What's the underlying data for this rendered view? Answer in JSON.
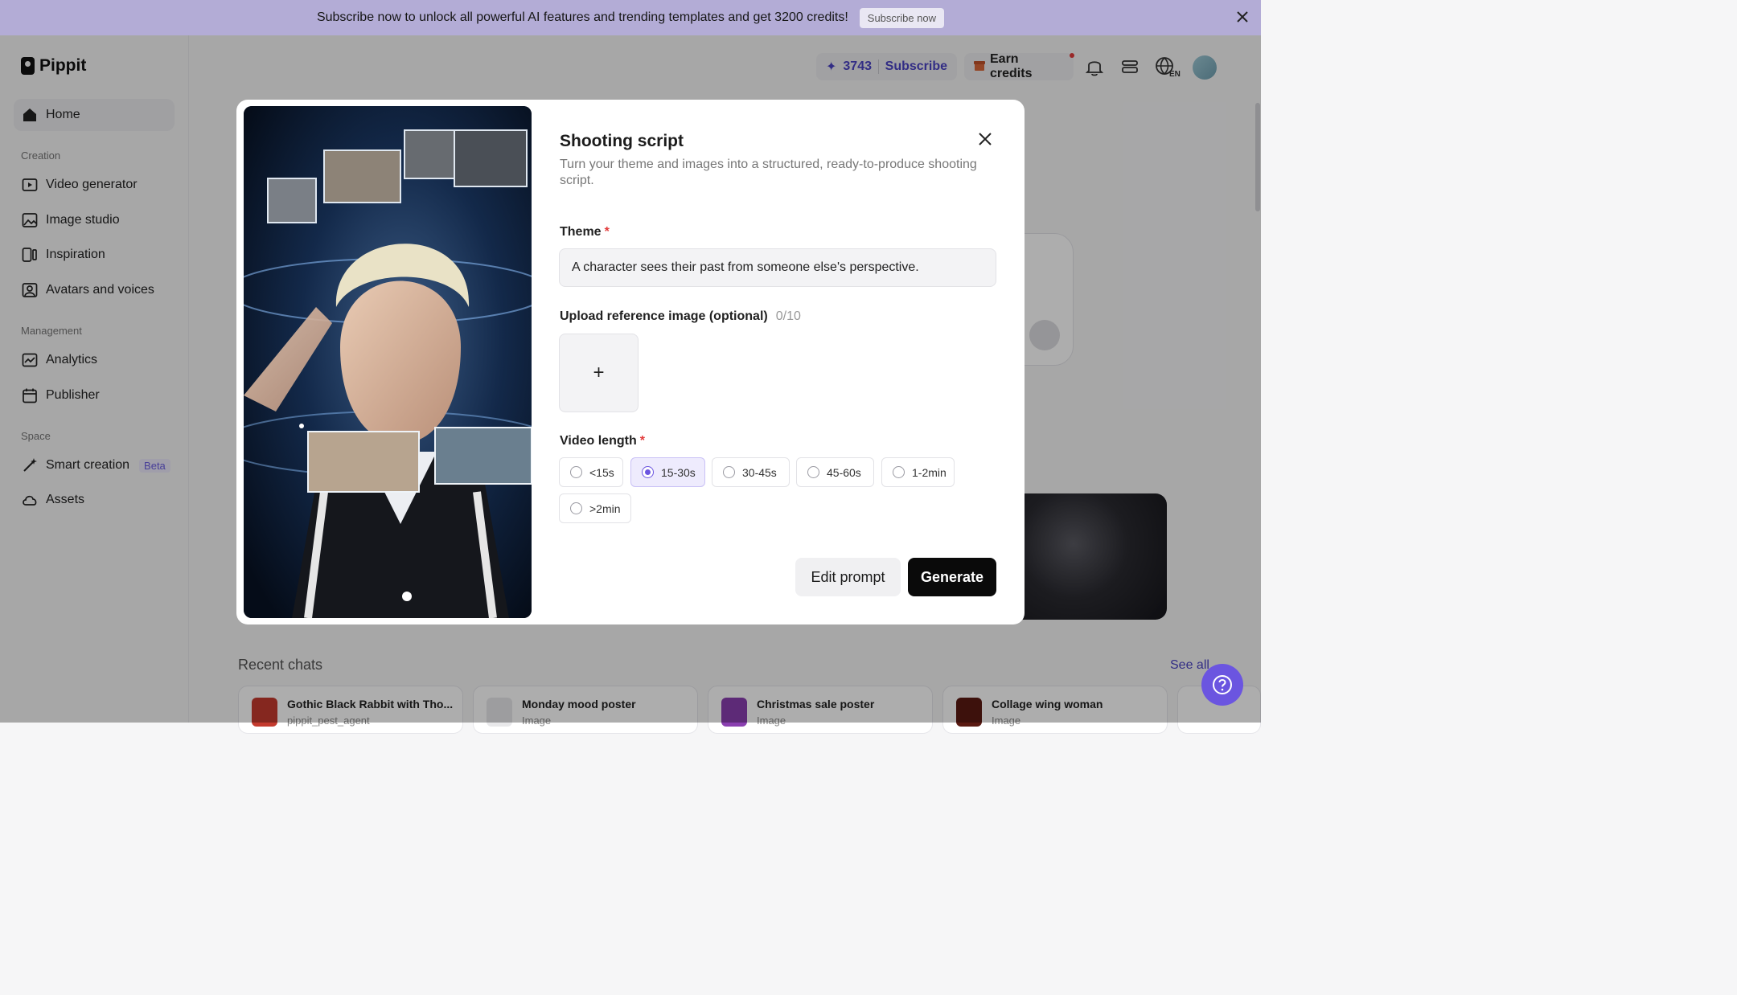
{
  "banner": {
    "text": "Subscribe now to unlock all powerful AI features and trending templates and get 3200 credits!",
    "button": "Subscribe now"
  },
  "brand": {
    "name": "Pippit"
  },
  "sidebar": {
    "home": "Home",
    "sections": {
      "creation": "Creation",
      "management": "Management",
      "space": "Space"
    },
    "creation_items": [
      "Video generator",
      "Image studio",
      "Inspiration",
      "Avatars and voices"
    ],
    "management_items": [
      "Analytics",
      "Publisher"
    ],
    "space_items": [
      "Smart creation",
      "Assets"
    ],
    "beta_badge": "Beta"
  },
  "header": {
    "credits": "3743",
    "subscribe": "Subscribe",
    "earn_credits": "Earn credits"
  },
  "modal": {
    "title": "Shooting script",
    "description": "Turn your theme and images into a structured, ready-to-produce shooting script.",
    "theme_label": "Theme",
    "theme_value": "A character sees their past from someone else's perspective.",
    "upload_label": "Upload reference image (optional)",
    "upload_count": "0/10",
    "upload_plus": "+",
    "video_length_label": "Video length",
    "video_length_options": [
      "<15s",
      "15-30s",
      "30-45s",
      "45-60s",
      "1-2min",
      ">2min"
    ],
    "video_length_selected": "15-30s",
    "edit_prompt": "Edit prompt",
    "generate": "Generate",
    "required_mark": "*"
  },
  "recent": {
    "title": "Recent chats",
    "see_all": "See all",
    "chats": [
      {
        "title": "Gothic Black Rabbit with Tho...",
        "sub": "pippit_pest_agent"
      },
      {
        "title": "Monday mood poster",
        "sub": "Image"
      },
      {
        "title": "Christmas sale poster",
        "sub": "Image"
      },
      {
        "title": "Collage wing woman",
        "sub": "Image"
      }
    ]
  },
  "colors": {
    "accent": "#6b55e0",
    "banner": "#b3acd6",
    "brand_link": "#4b43c4"
  }
}
